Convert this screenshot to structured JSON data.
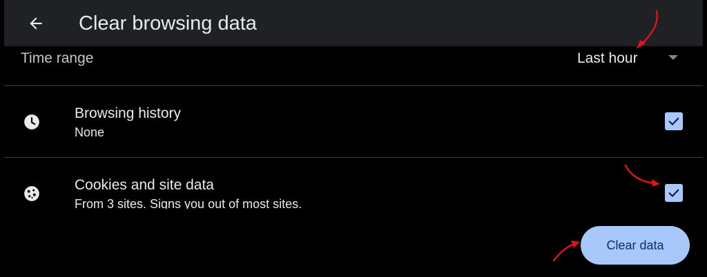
{
  "header": {
    "title": "Clear browsing data",
    "back_icon": "arrow-left-icon"
  },
  "time_range": {
    "label": "Time range",
    "selected": "Last hour"
  },
  "options": [
    {
      "icon": "clock-icon",
      "title": "Browsing history",
      "subtitle": "None",
      "checked": true
    },
    {
      "icon": "cookie-icon",
      "title": "Cookies and site data",
      "subtitle": "From 3 sites. Signs you out of most sites.",
      "checked": true
    }
  ],
  "actions": {
    "clear_label": "Clear data"
  },
  "colors": {
    "accent": "#a8c7fa",
    "annotation": "#e0141e",
    "app_bar": "#202124"
  }
}
